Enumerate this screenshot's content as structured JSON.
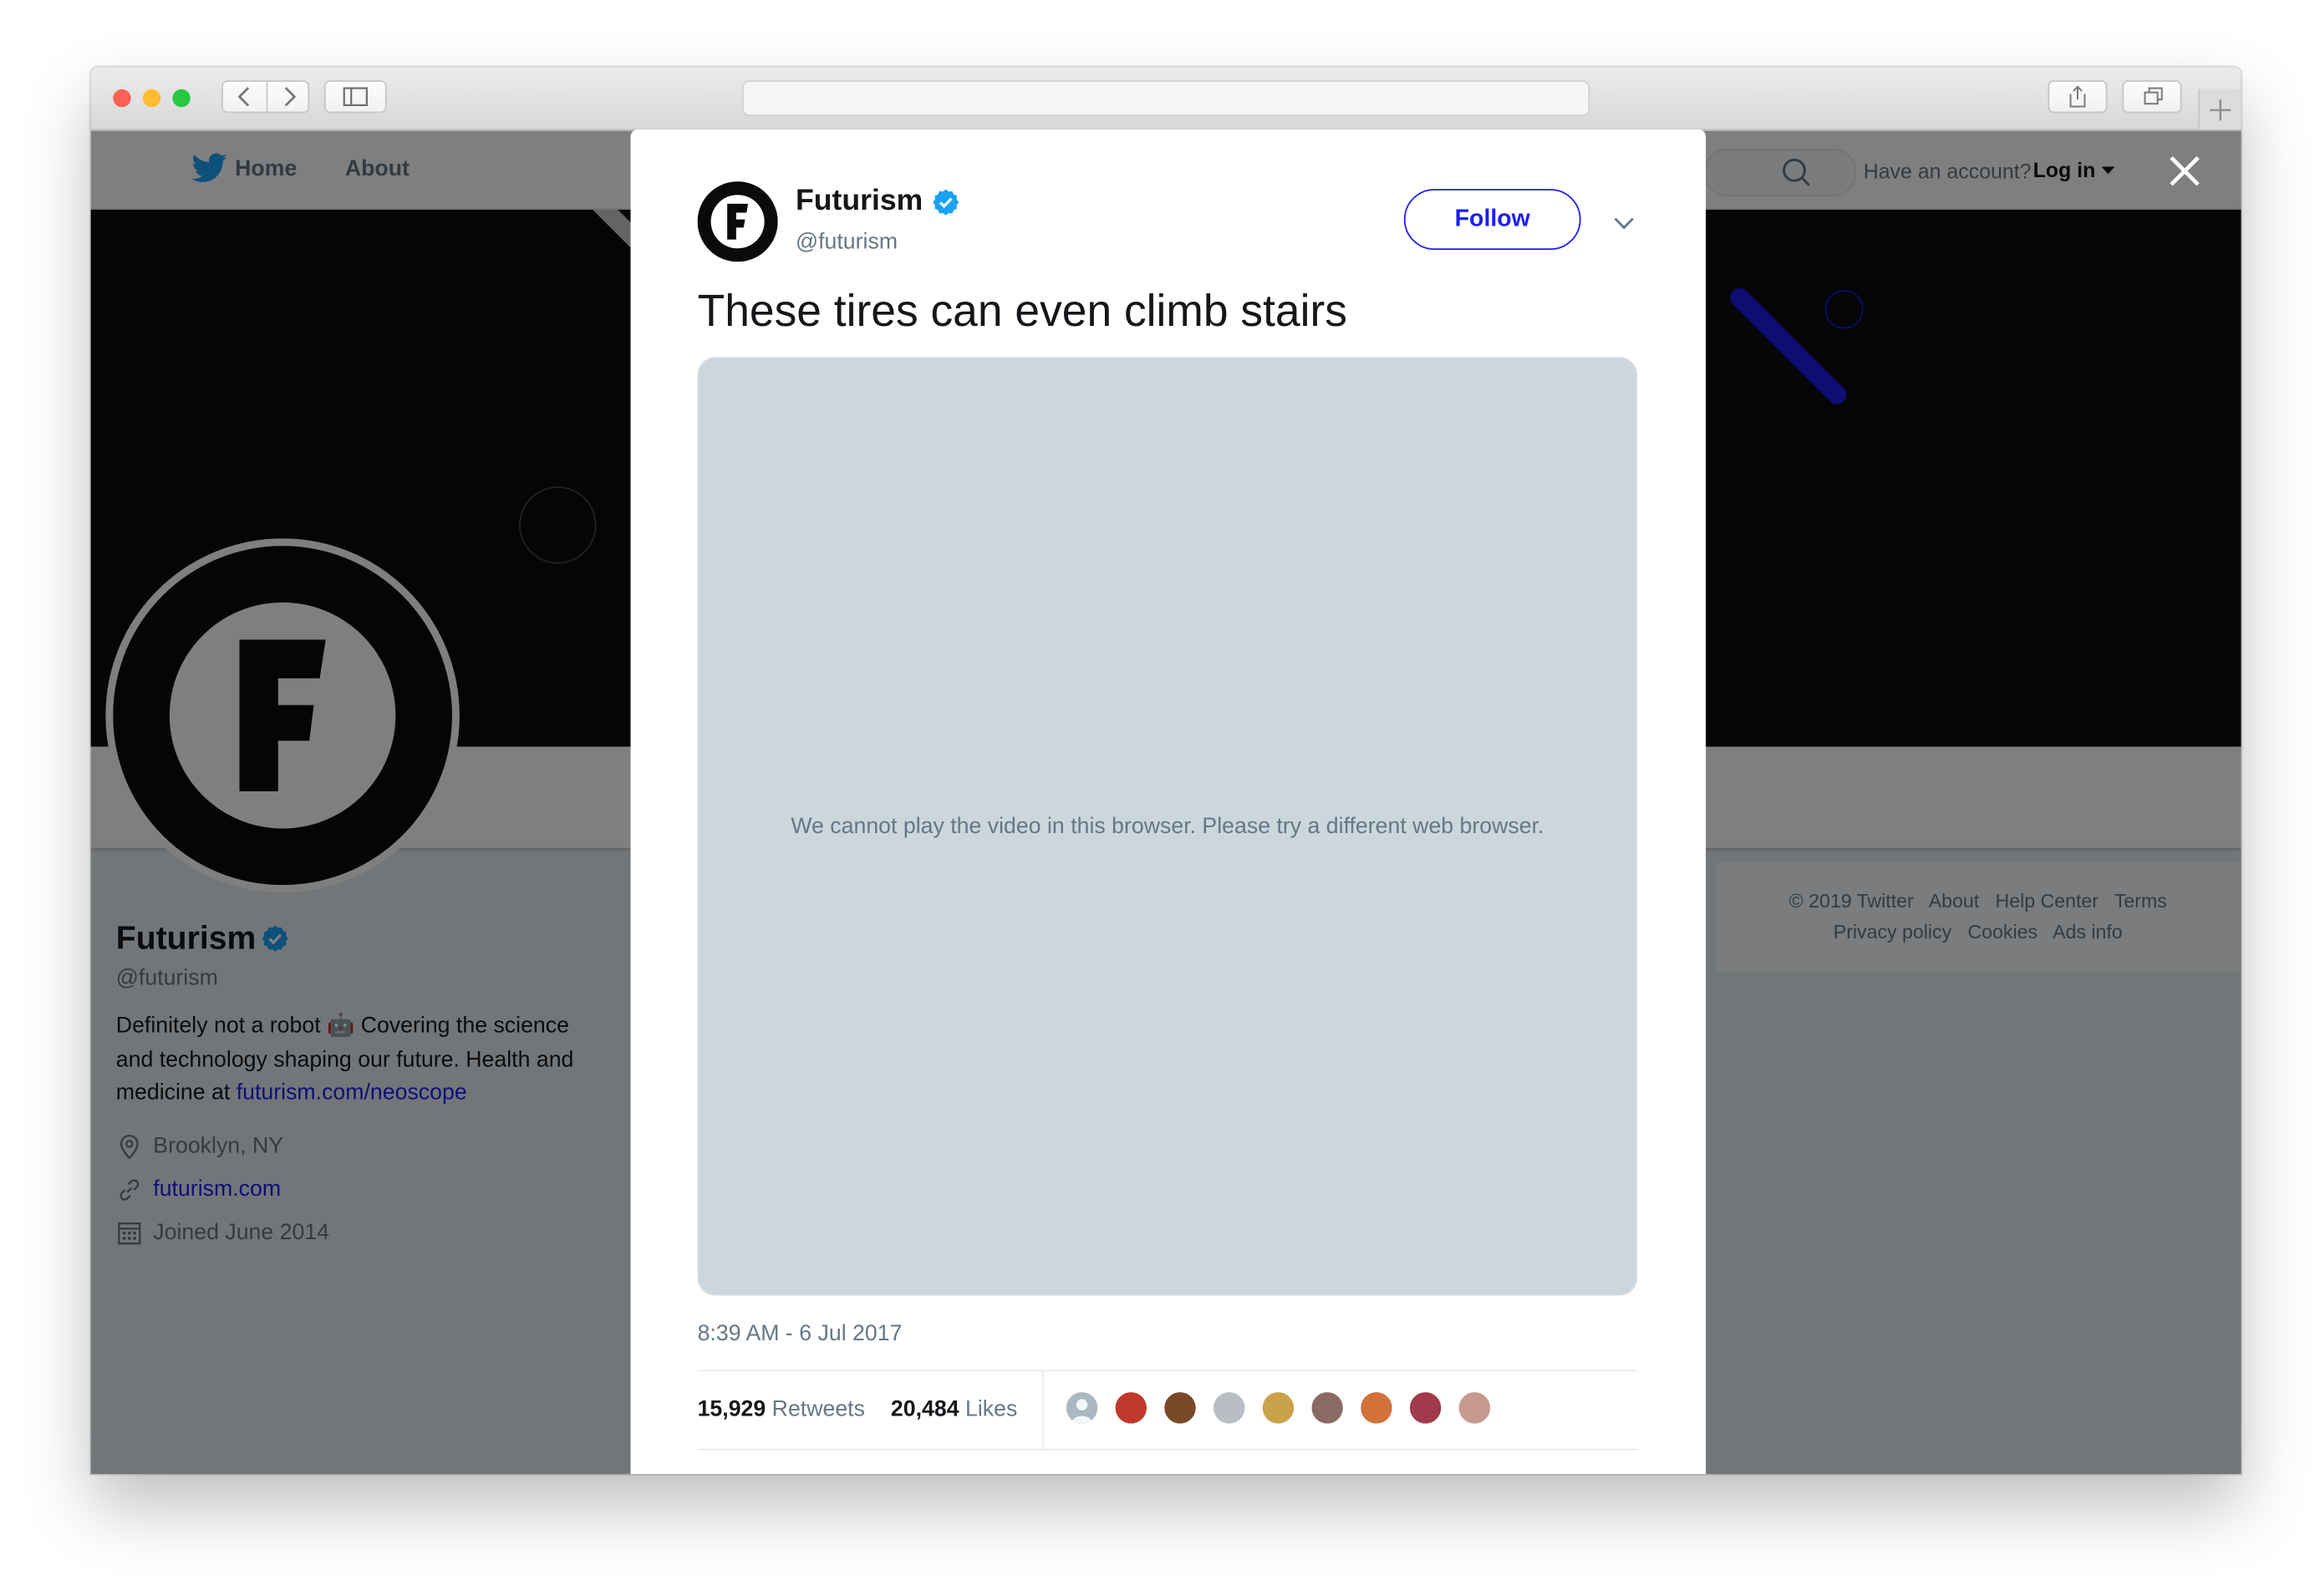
{
  "browser": {
    "url": "",
    "traffic_lights": {
      "close": "#fe5f57",
      "minimize": "#febc2e",
      "maximize": "#28c840"
    }
  },
  "nav": {
    "home_label": "Home",
    "about_label": "About",
    "account_prompt": "Have an account?",
    "login_label": "Log in"
  },
  "profile": {
    "name": "Futurism",
    "handle": "@futurism",
    "bio_text": "Definitely not a robot 🤖 Covering the science and technology shaping our future. Health and medicine at",
    "bio_link": "futurism.com/neoscope",
    "location": "Brooklyn, NY",
    "website": "futurism.com",
    "joined": "Joined June 2014"
  },
  "footer": {
    "row1": [
      "© 2019 Twitter",
      "About",
      "Help Center",
      "Terms"
    ],
    "row2": [
      "Privacy policy",
      "Cookies",
      "Ads info"
    ]
  },
  "tweet": {
    "author_name": "Futurism",
    "author_handle": "@futurism",
    "follow_label": "Follow",
    "text": "These tires can even climb stairs",
    "video_message": "We cannot play the video in this browser. Please try a different web browser.",
    "timestamp": "8:39 AM - 6 Jul 2017",
    "retweets_count": "15,929",
    "retweets_label": "Retweets",
    "likes_count": "20,484",
    "likes_label": "Likes",
    "liker_avatars": [
      "#aab8c2",
      "#c0392b",
      "#7a4a28",
      "#b9bec4",
      "#c9a24a",
      "#8b6a65",
      "#d2713a",
      "#a23a4d",
      "#c79a90"
    ]
  },
  "colors": {
    "link": "#1b1ff0",
    "verified": "#1da1f2",
    "twitter_blue": "#1da1f2",
    "banner_accent": "#1a1ae6"
  }
}
